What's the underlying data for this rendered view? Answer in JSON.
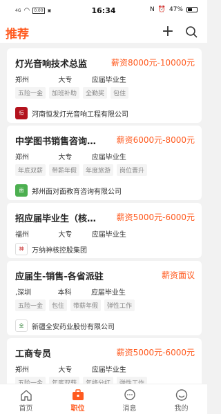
{
  "status_bar": {
    "network": "4G",
    "speed": "0.00\nKB/s",
    "time": "16:34",
    "battery": "47%"
  },
  "header": {
    "title": "推荐",
    "plus_icon": "plus-icon",
    "search_icon": "search-icon"
  },
  "colors": {
    "accent": "#ff5a1f"
  },
  "jobs": [
    {
      "title": "灯光音响技术总监",
      "salary": "薪资8000元-10000元",
      "location": "郑州",
      "education": "大专",
      "experience": "应届毕业生",
      "tags": [
        "五险一金",
        "加班补助",
        "全勤奖",
        "包住"
      ],
      "company": "河南恒发灯光音响工程有限公司",
      "logo_color": "#b3121d"
    },
    {
      "title": "中学图书销售咨询…",
      "salary": "薪资6000元-8000元",
      "location": "郑州",
      "education": "大专",
      "experience": "应届毕业生",
      "tags": [
        "年底双薪",
        "带薪年假",
        "年度旅游",
        "岗位晋升"
      ],
      "company": "郑州面对面教育咨询有限公司",
      "logo_color": "#4caf50"
    },
    {
      "title": "招应届毕业生（核…",
      "salary": "薪资5000元-6000元",
      "location": "福州",
      "education": "大专",
      "experience": "应届毕业生",
      "tags": [],
      "company": "万纳神核控股集团",
      "logo_color": "#c62828"
    },
    {
      "title": "应届生-销售-各省派驻",
      "salary": "薪资面议",
      "location": ",深圳",
      "education": "本科",
      "experience": "应届毕业生",
      "tags": [
        "五险一金",
        "包住",
        "带薪年假",
        "弹性工作"
      ],
      "company": "新疆全安药业股份有限公司",
      "logo_color": "#2e7d32"
    },
    {
      "title": "工商专员",
      "salary": "薪资5000元-6000元",
      "location": "郑州",
      "education": "大专",
      "experience": "应届毕业生",
      "tags": [
        "五险一金",
        "年底双薪",
        "年终分红",
        "弹性工作"
      ],
      "company": "",
      "logo_color": "#999999"
    }
  ],
  "tabbar": [
    {
      "label": "首页",
      "icon": "home-icon"
    },
    {
      "label": "职位",
      "icon": "briefcase-icon"
    },
    {
      "label": "消息",
      "icon": "message-icon"
    },
    {
      "label": "我的",
      "icon": "profile-icon"
    }
  ]
}
